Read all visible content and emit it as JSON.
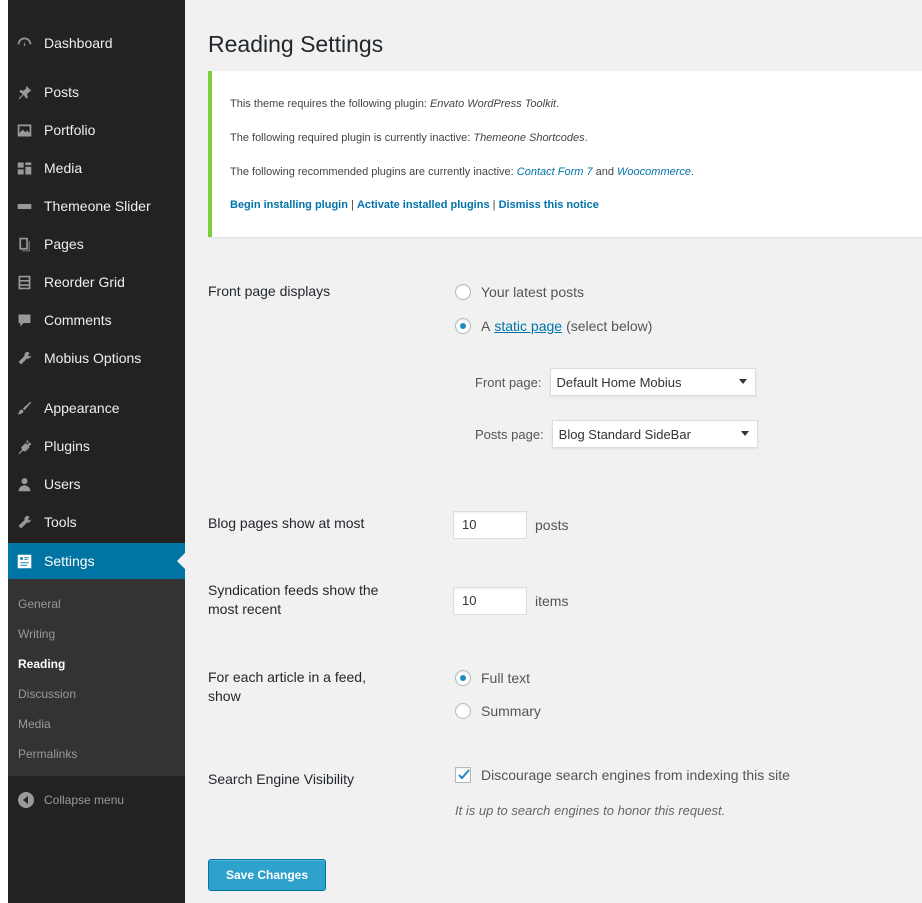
{
  "sidebar": {
    "items": [
      {
        "label": "Dashboard",
        "icon": "dashboard-icon"
      },
      {
        "label": "Posts",
        "icon": "pin-icon"
      },
      {
        "label": "Portfolio",
        "icon": "portfolio-icon"
      },
      {
        "label": "Media",
        "icon": "media-icon"
      },
      {
        "label": "Themeone Slider",
        "icon": "slider-icon"
      },
      {
        "label": "Pages",
        "icon": "pages-icon"
      },
      {
        "label": "Reorder Grid",
        "icon": "grid-icon"
      },
      {
        "label": "Comments",
        "icon": "comments-icon"
      },
      {
        "label": "Mobius Options",
        "icon": "wrench-icon"
      },
      {
        "label": "Appearance",
        "icon": "brush-icon"
      },
      {
        "label": "Plugins",
        "icon": "plugin-icon"
      },
      {
        "label": "Users",
        "icon": "users-icon"
      },
      {
        "label": "Tools",
        "icon": "tools-icon"
      },
      {
        "label": "Settings",
        "icon": "settings-icon"
      }
    ],
    "submenu": [
      "General",
      "Writing",
      "Reading",
      "Discussion",
      "Media",
      "Permalinks"
    ],
    "current_sub": "Reading",
    "collapse_label": "Collapse menu"
  },
  "page": {
    "title": "Reading Settings"
  },
  "notice": {
    "line1_prefix": "This theme requires the following plugin: ",
    "line1_plugin": "Envato WordPress Toolkit",
    "line1_suffix": ".",
    "line2_prefix": "The following required plugin is currently inactive: ",
    "line2_plugin": "Themeone Shortcodes",
    "line2_suffix": ".",
    "line3_prefix": "The following recommended plugins are currently inactive: ",
    "line3_plugin1": "Contact Form 7",
    "line3_and": " and ",
    "line3_plugin2": "Woocommerce",
    "line3_suffix": ".",
    "link_begin": "Begin installing plugin",
    "link_activate": "Activate installed plugins",
    "link_dismiss": "Dismiss this notice",
    "separator": " | "
  },
  "front_page": {
    "label": "Front page displays",
    "option_latest": "Your latest posts",
    "option_static_prefix": "A",
    "option_static_link": "static page",
    "option_static_suffix": "(select below)",
    "front_page_label": "Front page:",
    "front_page_value": "Default Home Mobius",
    "posts_page_label": "Posts page:",
    "posts_page_value": "Blog Standard SideBar"
  },
  "blog_pages": {
    "label": "Blog pages show at most",
    "value": "10",
    "unit": "posts"
  },
  "syndication": {
    "label_line1": "Syndication feeds show the",
    "label_line2": "most recent",
    "value": "10",
    "unit": "items"
  },
  "feed_article": {
    "label_line1": "For each article in a feed,",
    "label_line2": "show",
    "option_full": "Full text",
    "option_summary": "Summary"
  },
  "search_engine": {
    "label": "Search Engine Visibility",
    "checkbox_label": "Discourage search engines from indexing this site",
    "description": "It is up to search engines to honor this request."
  },
  "save_button": "Save Changes",
  "colors": {
    "sidebar_bg": "#222222",
    "active_bg": "#0074a2",
    "notice_border": "#7ad03a",
    "link": "#0073aa",
    "button": "#2ea2cc"
  }
}
